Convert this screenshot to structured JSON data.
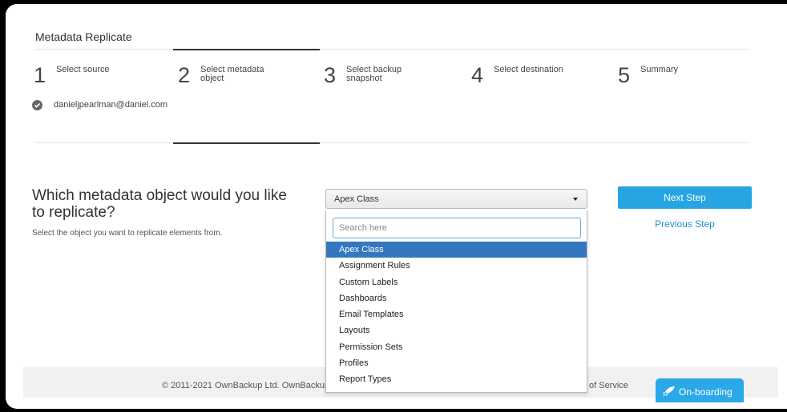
{
  "page": {
    "title": "Metadata Replicate"
  },
  "steps": [
    {
      "number": "1",
      "label": "Select source"
    },
    {
      "number": "2",
      "label": "Select metadata object"
    },
    {
      "number": "3",
      "label": "Select backup snapshot"
    },
    {
      "number": "4",
      "label": "Select destination"
    },
    {
      "number": "5",
      "label": "Summary"
    }
  ],
  "active_step": 2,
  "source": {
    "email": "danieljpearlman@daniel.com",
    "status_icon": "check-circle-icon"
  },
  "question": {
    "heading": "Which metadata object would you like to replicate?",
    "subtext": "Select the object you want to replicate elements from."
  },
  "select": {
    "value": "Apex Class",
    "search_placeholder": "Search here",
    "options": [
      "Apex Class",
      "Assignment Rules",
      "Custom Labels",
      "Dashboards",
      "Email Templates",
      "Layouts",
      "Permission Sets",
      "Profiles",
      "Report Types"
    ],
    "selected_index": 0
  },
  "actions": {
    "next": "Next Step",
    "previous": "Previous Step"
  },
  "footer": {
    "copyright": "© 2011-2021 OwnBackup Ltd. OwnBackup",
    "terms_fragment": "of Service"
  },
  "onboarding": {
    "label": "On-boarding",
    "icon": "rocket-icon"
  },
  "colors": {
    "primary": "#26a5e2",
    "selected": "#3477c0",
    "link": "#1f8fd3"
  }
}
